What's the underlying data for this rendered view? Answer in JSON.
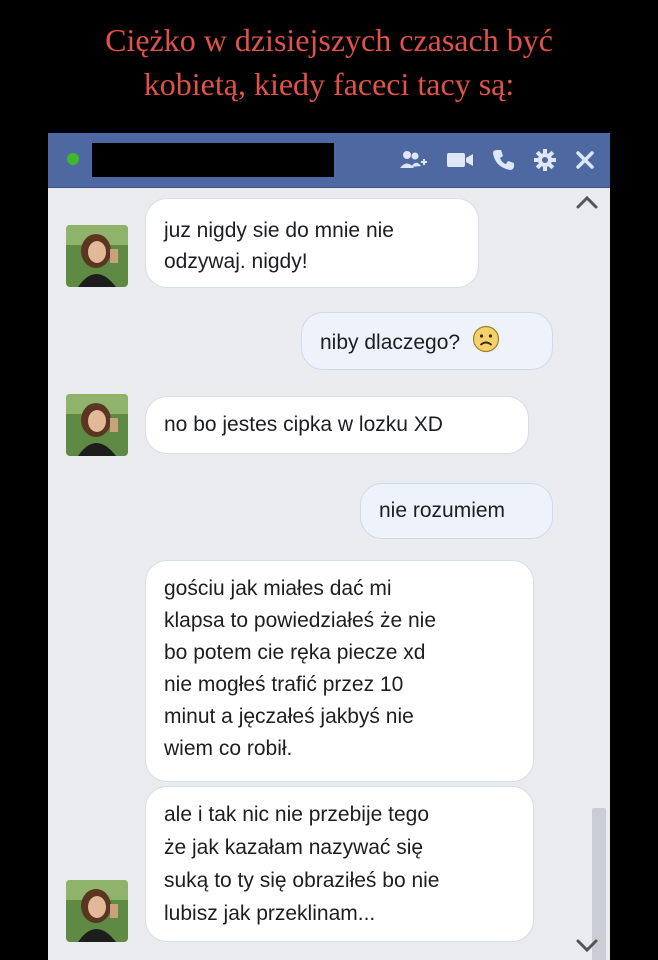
{
  "caption": {
    "line1": "Ciężko w dzisiejszych czasach być",
    "line2": "kobietą, kiedy faceci tacy są:"
  },
  "chat_window": {
    "status": "online",
    "icons": [
      "add-friend-icon",
      "video-call-icon",
      "phone-icon",
      "gear-icon",
      "close-icon"
    ],
    "colors": {
      "titlebar": "#4e69a2",
      "background": "#e9ebee",
      "status_dot": "#42b72a",
      "caption": "#e0524a"
    }
  },
  "messages": [
    {
      "sender": "them",
      "text": "juz nigdy sie do mnie nie odzywaj. nigdy!",
      "lines": [
        "juz nigdy sie do mnie nie",
        "odzywaj. nigdy!"
      ]
    },
    {
      "sender": "me",
      "text": "niby dlaczego?",
      "emoji": "sad-face-icon"
    },
    {
      "sender": "them",
      "text": "no bo jestes cipka w lozku XD"
    },
    {
      "sender": "me",
      "text": "nie rozumiem"
    },
    {
      "sender": "them",
      "lines": [
        "gościu jak miałes dać mi",
        "klapsa to powiedziałeś że nie",
        "bo potem cie ręka piecze xd",
        "nie mogłeś trafić przez 10",
        "minut a jęczałeś jakbyś nie",
        "wiem co robił."
      ]
    },
    {
      "sender": "them",
      "lines": [
        "ale i tak nic nie przebije tego",
        "że jak kazałam nazywać się",
        "suką to ty się obraziłeś bo nie",
        "lubisz jak przeklinam..."
      ]
    }
  ]
}
